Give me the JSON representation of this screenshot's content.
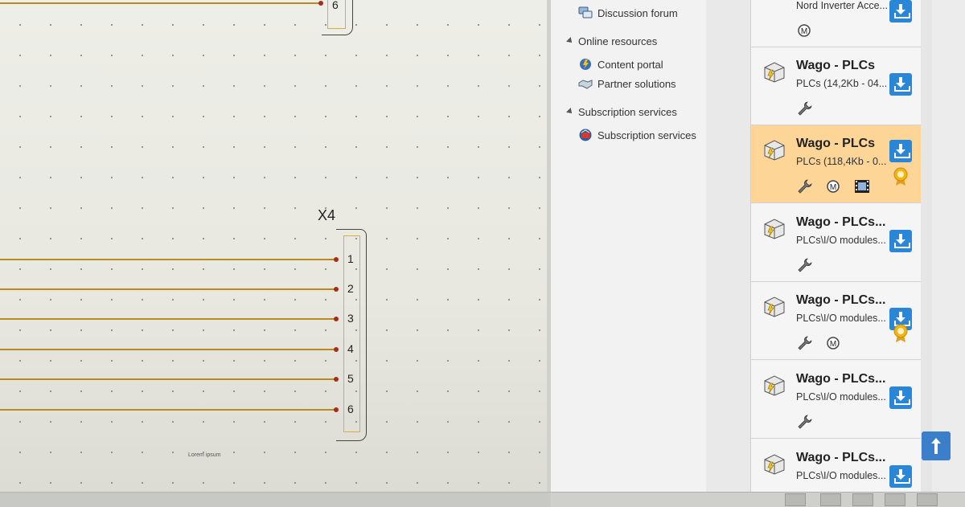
{
  "schematic": {
    "top_pin": "6",
    "terminal_label": "X4",
    "pins": [
      "1",
      "2",
      "3",
      "4",
      "5",
      "6"
    ],
    "note": "Lorem ipsum"
  },
  "nav": {
    "partial_top": "Discussion forum",
    "sections": [
      {
        "title": "Online resources",
        "items": [
          "Content portal",
          "Partner solutions"
        ]
      },
      {
        "title": "Subscription services",
        "items": [
          "Subscription services"
        ]
      }
    ]
  },
  "downloads": {
    "partial_top_title": "Nord Inverter Acce...",
    "cards": [
      {
        "title": "Wago - PLCs",
        "subtitle": "PLCs (14,2Kb - 04...",
        "selected": false
      },
      {
        "title": "Wago - PLCs",
        "subtitle": "PLCs (118,4Kb - 0...",
        "selected": true
      },
      {
        "title": "Wago - PLCs...",
        "subtitle": "PLCs\\I/O modules...",
        "selected": false
      },
      {
        "title": "Wago - PLCs...",
        "subtitle": "PLCs\\I/O modules...",
        "selected": false
      },
      {
        "title": "Wago - PLCs...",
        "subtitle": "PLCs\\I/O modules...",
        "selected": false
      },
      {
        "title": "Wago - PLCs...",
        "subtitle": "PLCs\\I/O modules...",
        "selected": false
      }
    ]
  },
  "colors": {
    "wire": "#b88b20",
    "selection": "#fcd597",
    "download_button": "#2a86d6",
    "node": "#a82c1a"
  },
  "icons": {
    "nav": [
      "chat-icon",
      "content-portal-icon",
      "handshake-icon",
      "subscription-icon"
    ],
    "card_features": [
      "wrench-icon",
      "macro-icon",
      "film-icon",
      "award-icon",
      "download-icon"
    ]
  }
}
